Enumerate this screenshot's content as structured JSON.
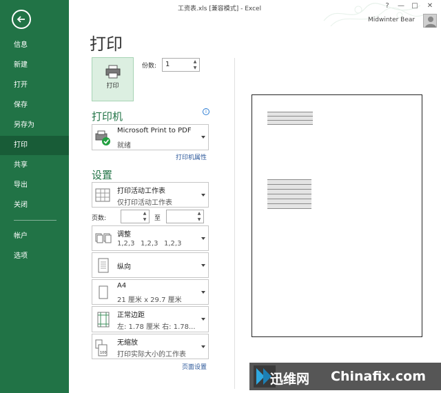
{
  "app": {
    "title": "工资表.xls  [兼容模式] - Excel",
    "user_name": "Midwinter Bear",
    "window_controls": [
      "?",
      "—",
      "□",
      "✕"
    ]
  },
  "sidebar": {
    "items": [
      {
        "label": "信息"
      },
      {
        "label": "新建"
      },
      {
        "label": "打开"
      },
      {
        "label": "保存"
      },
      {
        "label": "另存为"
      },
      {
        "label": "打印",
        "active": true
      },
      {
        "label": "共享"
      },
      {
        "label": "导出"
      },
      {
        "label": "关闭"
      },
      {
        "label": "帐户"
      },
      {
        "label": "选项"
      }
    ]
  },
  "print": {
    "page_title": "打印",
    "print_button_label": "打印",
    "copies_label": "份数:",
    "copies_value": "1"
  },
  "printer": {
    "section_title": "打印机",
    "name": "Microsoft Print to PDF",
    "status": "就绪",
    "properties_link": "打印机属性"
  },
  "settings": {
    "section_title": "设置",
    "print_what": {
      "title": "打印活动工作表",
      "desc": "仅打印活动工作表"
    },
    "pages_label": "页数:",
    "pages_to_label": "至",
    "collate": {
      "title": "调整",
      "desc1": "1,2,3",
      "desc2": "1,2,3",
      "desc3": "1,2,3"
    },
    "orientation": {
      "title": "纵向"
    },
    "paper": {
      "title": "A4",
      "desc": "21 厘米 x 29.7 厘米"
    },
    "margins": {
      "title": "正常边距",
      "desc": "左: 1.78 厘米    右: 1.78..."
    },
    "scaling": {
      "title": "无缩放",
      "desc": "打印实际大小的工作表"
    },
    "page_setup_link": "页面设置"
  },
  "watermark": {
    "text1": "迅维网",
    "text2": "Chinafix.com"
  },
  "colors": {
    "accent": "#217346",
    "active_nav": "#185c37",
    "link": "#2b579a"
  }
}
